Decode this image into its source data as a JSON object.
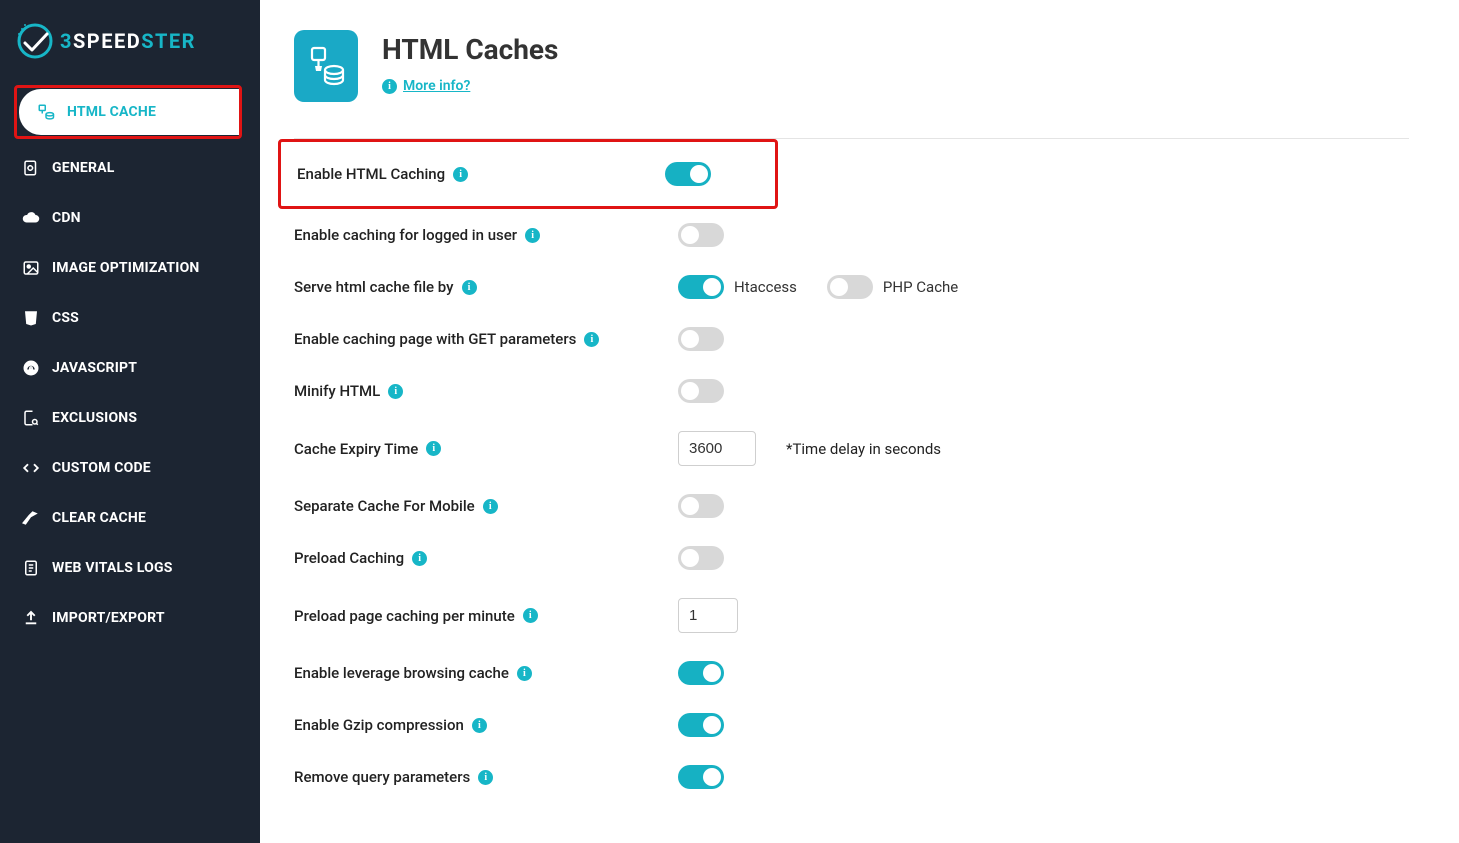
{
  "brand": {
    "w3": "3",
    "speed": "SPEED",
    "ster": "STER"
  },
  "sidebar": {
    "items": [
      {
        "label": "HTML CACHE"
      },
      {
        "label": "GENERAL"
      },
      {
        "label": "CDN"
      },
      {
        "label": "IMAGE OPTIMIZATION"
      },
      {
        "label": "CSS"
      },
      {
        "label": "JAVASCRIPT"
      },
      {
        "label": "EXCLUSIONS"
      },
      {
        "label": "CUSTOM CODE"
      },
      {
        "label": "CLEAR CACHE"
      },
      {
        "label": "WEB VITALS LOGS"
      },
      {
        "label": "IMPORT/EXPORT"
      }
    ]
  },
  "page": {
    "title": "HTML Caches",
    "more_info": "More info?"
  },
  "settings": {
    "enable_html_caching": {
      "label": "Enable HTML Caching",
      "on": true
    },
    "enable_logged_in": {
      "label": "Enable caching for logged in user",
      "on": false
    },
    "serve_by": {
      "label": "Serve html cache file by",
      "htaccess_on": true,
      "htaccess_label": "Htaccess",
      "php_on": false,
      "php_label": "PHP Cache"
    },
    "enable_get_params": {
      "label": "Enable caching page with GET parameters",
      "on": false
    },
    "minify_html": {
      "label": "Minify HTML",
      "on": false
    },
    "cache_expiry": {
      "label": "Cache Expiry Time",
      "value": "3600",
      "hint": "*Time delay in seconds"
    },
    "separate_mobile": {
      "label": "Separate Cache For Mobile",
      "on": false
    },
    "preload_caching": {
      "label": "Preload Caching",
      "on": false
    },
    "preload_per_minute": {
      "label": "Preload page caching per minute",
      "value": "1"
    },
    "leverage_browser": {
      "label": "Enable leverage browsing cache",
      "on": true
    },
    "gzip": {
      "label": "Enable Gzip compression",
      "on": true
    },
    "remove_query": {
      "label": "Remove query parameters",
      "on": true
    }
  }
}
